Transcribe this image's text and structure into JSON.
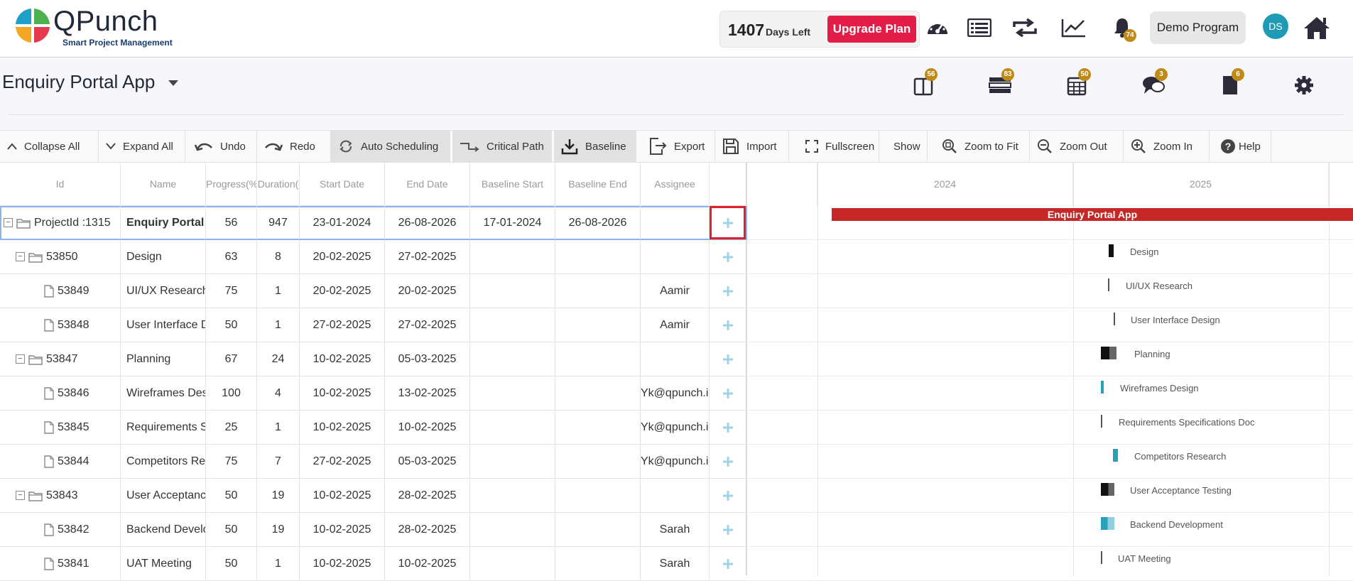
{
  "header": {
    "logo_text": "QPunch",
    "logo_sub": "Smart Project Management",
    "days_left_num": "1407",
    "days_left_label": "Days Left",
    "upgrade_label": "Upgrade Plan",
    "notification_count": "74",
    "demo_label": "Demo Program",
    "avatar_initials": "DS"
  },
  "project": {
    "title": "Enquiry Portal App",
    "badges": {
      "docs": "56",
      "tasks": "83",
      "calendar": "50",
      "chat": "3",
      "bookmark": "6"
    }
  },
  "toolbar": {
    "collapse_all": "Collapse All",
    "expand_all": "Expand All",
    "undo": "Undo",
    "redo": "Redo",
    "auto_scheduling": "Auto Scheduling",
    "critical_path": "Critical Path",
    "baseline": "Baseline",
    "export": "Export",
    "import": "Import",
    "fullscreen": "Fullscreen",
    "show": "Show",
    "zoom_to_fit": "Zoom to Fit",
    "zoom_out": "Zoom Out",
    "zoom_in": "Zoom In",
    "help": "Help"
  },
  "grid": {
    "columns": [
      "Id",
      "Name",
      "Progress(%",
      "Duration(",
      "Start Date",
      "End Date",
      "Baseline Start",
      "Baseline End",
      "Assignee"
    ],
    "rows": [
      {
        "id": "ProjectId :1315",
        "name": "Enquiry Portal App",
        "progress": "56",
        "duration": "947",
        "start": "23-01-2024",
        "end": "26-08-2026",
        "bstart": "17-01-2024",
        "bend": "26-08-2026",
        "assignee": ""
      },
      {
        "id": "53850",
        "name": "Design",
        "progress": "63",
        "duration": "8",
        "start": "20-02-2025",
        "end": "27-02-2025",
        "bstart": "",
        "bend": "",
        "assignee": ""
      },
      {
        "id": "53849",
        "name": "UI/UX Research",
        "progress": "75",
        "duration": "1",
        "start": "20-02-2025",
        "end": "20-02-2025",
        "bstart": "",
        "bend": "",
        "assignee": "Aamir"
      },
      {
        "id": "53848",
        "name": "User Interface Design",
        "progress": "50",
        "duration": "1",
        "start": "27-02-2025",
        "end": "27-02-2025",
        "bstart": "",
        "bend": "",
        "assignee": "Aamir"
      },
      {
        "id": "53847",
        "name": "Planning",
        "progress": "67",
        "duration": "24",
        "start": "10-02-2025",
        "end": "05-03-2025",
        "bstart": "",
        "bend": "",
        "assignee": ""
      },
      {
        "id": "53846",
        "name": "Wireframes Design",
        "progress": "100",
        "duration": "4",
        "start": "10-02-2025",
        "end": "13-02-2025",
        "bstart": "",
        "bend": "",
        "assignee": "Yk@qpunch.in"
      },
      {
        "id": "53845",
        "name": "Requirements Specifications Doc",
        "progress": "25",
        "duration": "1",
        "start": "10-02-2025",
        "end": "10-02-2025",
        "bstart": "",
        "bend": "",
        "assignee": "Yk@qpunch.in"
      },
      {
        "id": "53844",
        "name": "Competitors Research",
        "progress": "75",
        "duration": "7",
        "start": "27-02-2025",
        "end": "05-03-2025",
        "bstart": "",
        "bend": "",
        "assignee": "Yk@qpunch.in"
      },
      {
        "id": "53843",
        "name": "User Acceptance Testing",
        "progress": "50",
        "duration": "19",
        "start": "10-02-2025",
        "end": "28-02-2025",
        "bstart": "",
        "bend": "",
        "assignee": ""
      },
      {
        "id": "53842",
        "name": "Backend Development",
        "progress": "50",
        "duration": "19",
        "start": "10-02-2025",
        "end": "28-02-2025",
        "bstart": "",
        "bend": "",
        "assignee": "Sarah"
      },
      {
        "id": "53841",
        "name": "UAT Meeting",
        "progress": "50",
        "duration": "1",
        "start": "10-02-2025",
        "end": "10-02-2025",
        "bstart": "",
        "bend": "",
        "assignee": "Sarah"
      }
    ]
  },
  "gantt": {
    "years": [
      "2024",
      "2025"
    ],
    "labels": [
      "Enquiry Portal App",
      "Design",
      "UI/UX Research",
      "User Interface Design",
      "Planning",
      "Wireframes Design",
      "Requirements Specifications Doc",
      "Competitors Research",
      "User Acceptance Testing",
      "Backend Development",
      "UAT Meeting"
    ]
  },
  "colors": {
    "accent_red": "#e11d48",
    "project_bar": "#c62828",
    "badge": "#c08a17",
    "task_bar": "#2a9fb8"
  }
}
